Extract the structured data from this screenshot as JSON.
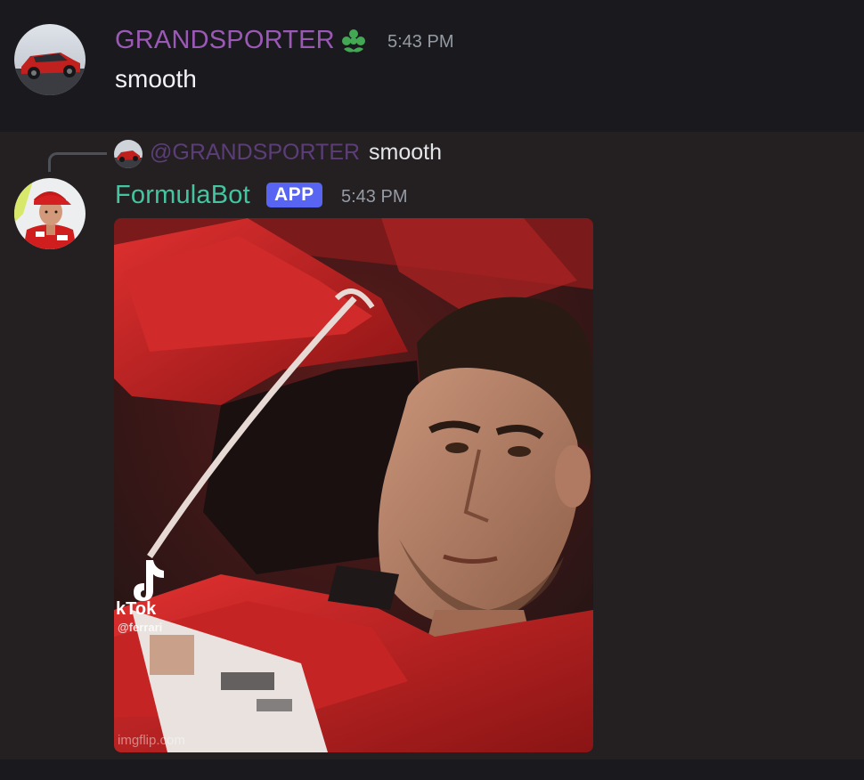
{
  "messages": [
    {
      "author": "GRANDSPORTER",
      "author_color": "#9b59b6",
      "badge_icon": "clover-role-icon",
      "timestamp": "5:43 PM",
      "content": "smooth"
    },
    {
      "reply": {
        "mention": "@GRANDSPORTER",
        "text": "smooth"
      },
      "author": "FormulaBot",
      "author_color": "#43c6a0",
      "badge": "APP",
      "timestamp": "5:43 PM",
      "attachment": {
        "watermark_tiktok": "kTok",
        "watermark_handle": "@ferrari",
        "watermark_site": "imgflip.com"
      }
    }
  ],
  "colors": {
    "background": "#1a1a1e",
    "highlight": "#242022",
    "app_badge": "#5865f2",
    "timestamp": "#949ba4"
  }
}
